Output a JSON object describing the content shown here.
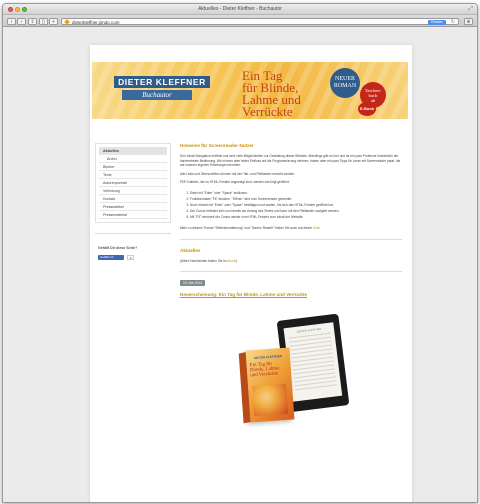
{
  "window": {
    "title": "Aktuelles - Dieter Kleffner - Buchautor",
    "url": "dieterkleffner.jimdo.com",
    "reader_label": "Reader"
  },
  "banner": {
    "author": "DIETER KLEFFNER",
    "subtitle": "Buchautor",
    "title_line1": "Ein Tag",
    "title_line2": "für Blinde,",
    "title_line3": "Lahme und",
    "title_line4": "Verrückte",
    "badge1_line1": "NEUER",
    "badge1_line2": "ROMAN",
    "badge2_line1": "Taschen-",
    "badge2_line2": "buch",
    "badge2_line3": "ab",
    "badge3": "E-Book"
  },
  "sidebar": {
    "items": [
      {
        "label": "Aktuelles"
      },
      {
        "label": "Archiv"
      },
      {
        "label": "Bücher"
      },
      {
        "label": "Texte"
      },
      {
        "label": "Autorenportrait"
      },
      {
        "label": "Verlinkung"
      },
      {
        "label": "Kontakt"
      },
      {
        "label": "Presseartikel"
      },
      {
        "label": "Pressematerial"
      }
    ],
    "like_question": "Gefällt Dir diese Seite?",
    "like_button": "Gefällt mir",
    "like_count": "0"
  },
  "content": {
    "section1_title": "Hinweise für Screenreader-Nutzer",
    "para1": "Den Inhalt-Navigation eröffnet uns sehr viele Möglichkeiten zur Gestaltung dieser Website. Allerdings gibt es hier und da ein paar Probleme hinsichtlich der barrierefreien Bedienung. Wir können aber leider Einfluss auf die Programmierung nehmen, haben aber ein paar Tipps für Leser mit Screenreader parat, die auf unseren eigenen Erfahrungen beruhen.",
    "para2": "Alle Links und Überschriften können mit den Tab- und Pfeiltasten erreicht werden.",
    "para3": "PDF-Dateien, die im HTML-Fenster angezeigt sind, werden wie folgt geöffnet:",
    "list": [
      "Datei mit \"Enter\" oder \"Space\" anklicken.",
      "Funktionstaste \"F6\" drücken. \"Öffnen\" wird vom Screenreader gemeldet.",
      "Noch einmal mit \"Enter\" oder \"Space\" bestätigen und warten, bis sich das HTML-Fenster geöffnet hat.",
      "Der Cursor befindet sich nun bereits am Anfang des Textes und kann mit den Pfeiltasten navigiert werden.",
      "Mit \"F5\" wechselt der Cursor wieder vom HTML-Fenster zum Inhalt der Website."
    ],
    "para4_prefix": "Mehr zu diesem Thema \"Seitenformatierung\" und \"Screen Reader\" finden Sie auch auf dieser ",
    "para4_link": "Seite",
    "section2_title": "Aktuelles",
    "para5_prefix": "(Ältere Nachrichten finden Sie im ",
    "para5_link": "Archiv",
    "para5_suffix": ")",
    "date_badge": "10. Nov 2014",
    "post_title": "Neuerscheinung: Ein Tag für Blinde, Lahme und Verrückte",
    "book_author": "DIETER KLEFFNER",
    "book_title": "Ein Tag für Blinde, Lahme und Verrückte"
  }
}
